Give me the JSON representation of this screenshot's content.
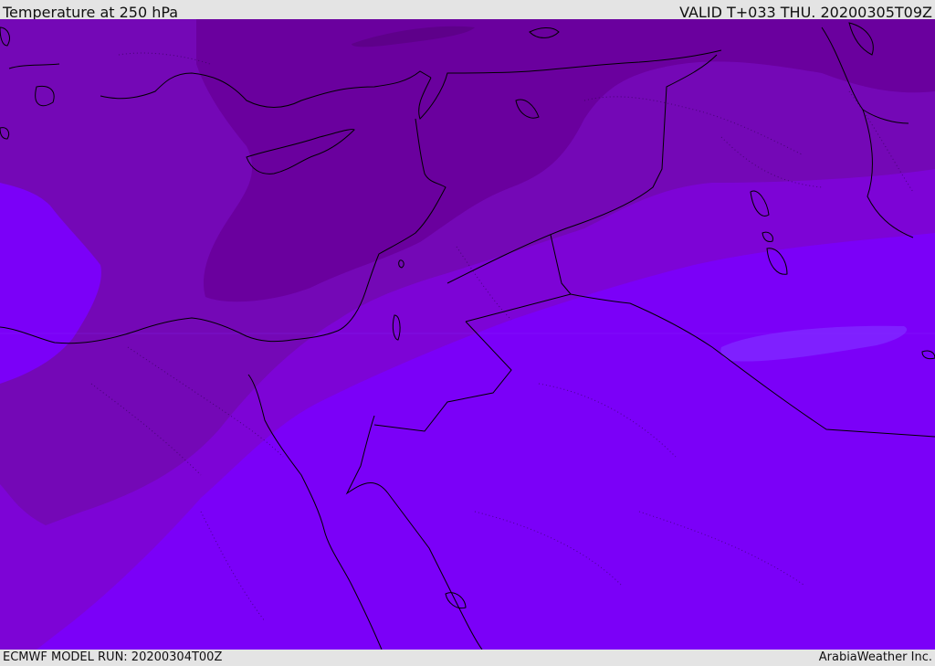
{
  "header": {
    "title": "Temperature at 250 hPa",
    "valid": "VALID T+033 THU. 20200305T09Z"
  },
  "footer": {
    "model_run": "ECMWF MODEL RUN: 20200304T00Z",
    "credit": "ArabiaWeather Inc."
  },
  "colors": {
    "bar_background": "#e4e4e4",
    "coldest_band": "#6a009e",
    "cold_band": "#7408b6",
    "mid_band": "#7d04d6",
    "warm_band": "#7b00f8",
    "warm_pocket": "#7f20ff",
    "coastline": "#000000"
  }
}
